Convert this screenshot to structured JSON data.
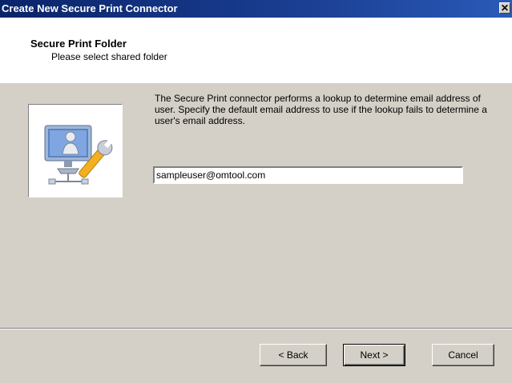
{
  "window": {
    "title": "Create New Secure Print Connector",
    "close_glyph": "✕"
  },
  "header": {
    "title": "Secure Print Folder",
    "subtitle": "Please select shared folder"
  },
  "main": {
    "icon": "computer-with-wrench-icon",
    "description": "The Secure Print connector performs a lookup to determine email address of user. Specify the default email address to use if the lookup fails to determine a user's email address.",
    "email_value": "sampleuser@omtool.com"
  },
  "buttons": {
    "back": "< Back",
    "next": "Next >",
    "cancel": "Cancel"
  },
  "colors": {
    "titlebar": "#0a246a",
    "face": "#d4d0c8"
  }
}
